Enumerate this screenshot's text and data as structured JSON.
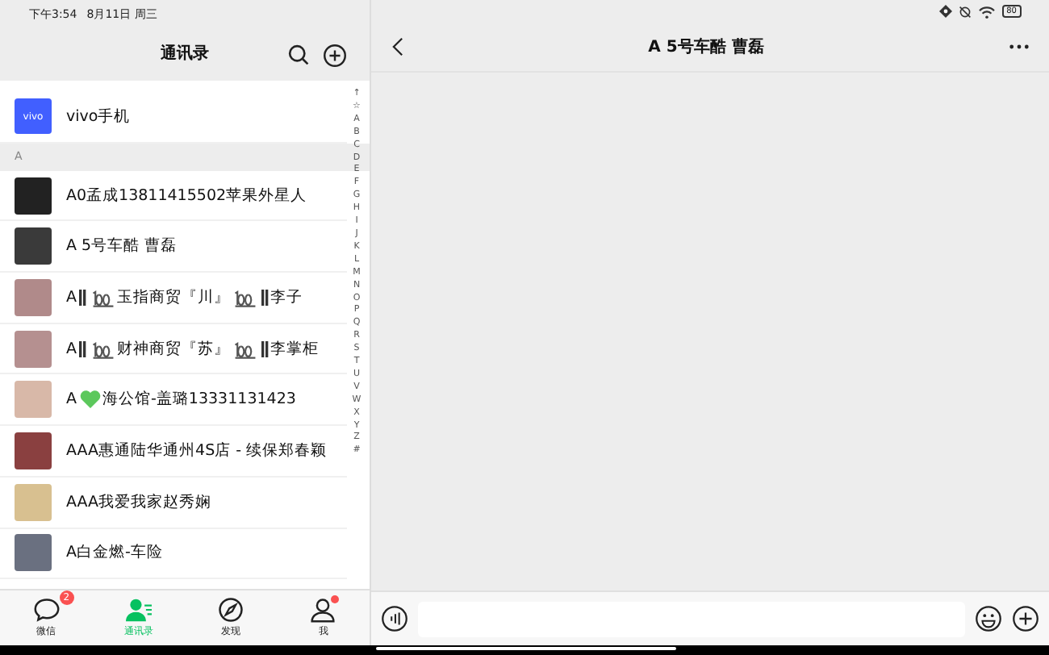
{
  "status_bar": {
    "time": "下午3:54",
    "date": "8月11日 周三",
    "battery": "80"
  },
  "contacts_panel": {
    "title": "通讯录",
    "pinned": {
      "name": "vivo手机",
      "avatar_text": "vivo"
    },
    "section": "A",
    "contacts": [
      {
        "parts": [
          {
            "kind": "text",
            "text": "A0孟成13811415502苹果外星人"
          }
        ],
        "color": "#222222"
      },
      {
        "parts": [
          {
            "kind": "text",
            "text": "A 5号车酷 曹磊"
          }
        ],
        "color": "#3a3a3a"
      },
      {
        "parts": [
          {
            "kind": "text",
            "text": "A"
          },
          {
            "kind": "bars"
          },
          {
            "kind": "hundred"
          },
          {
            "kind": "text",
            "text": "玉指商贸『川』"
          },
          {
            "kind": "hundred"
          },
          {
            "kind": "bars"
          },
          {
            "kind": "text",
            "text": "李子"
          }
        ],
        "color": "#b08a8a"
      },
      {
        "parts": [
          {
            "kind": "text",
            "text": "A"
          },
          {
            "kind": "bars"
          },
          {
            "kind": "hundred"
          },
          {
            "kind": "text",
            "text": "财神商贸『苏』"
          },
          {
            "kind": "hundred"
          },
          {
            "kind": "bars"
          },
          {
            "kind": "text",
            "text": "李掌柜"
          }
        ],
        "color": "#b59090"
      },
      {
        "parts": [
          {
            "kind": "text",
            "text": "A"
          },
          {
            "kind": "heart"
          },
          {
            "kind": "text",
            "text": "海公馆-盖璐13331131423"
          }
        ],
        "color": "#d8b8a8"
      },
      {
        "parts": [
          {
            "kind": "text",
            "text": "AAA惠通陆华通州4S店 - 续保郑春颖"
          }
        ],
        "color": "#8a4040"
      },
      {
        "parts": [
          {
            "kind": "text",
            "text": "AAA我爱我家赵秀娴"
          }
        ],
        "color": "#d8c090"
      },
      {
        "parts": [
          {
            "kind": "text",
            "text": "A白金燃-车险"
          }
        ],
        "color": "#6a7080"
      }
    ],
    "index": [
      "↑",
      "☆",
      "A",
      "B",
      "C",
      "D",
      "E",
      "F",
      "G",
      "H",
      "I",
      "J",
      "K",
      "L",
      "M",
      "N",
      "O",
      "P",
      "Q",
      "R",
      "S",
      "T",
      "U",
      "V",
      "W",
      "X",
      "Y",
      "Z",
      "#"
    ]
  },
  "tab_bar": [
    {
      "label": "微信",
      "kind": "chat",
      "badge": "2",
      "dot": false,
      "selected": false
    },
    {
      "label": "通讯录",
      "kind": "contacts",
      "dot": false,
      "selected": true
    },
    {
      "label": "发现",
      "kind": "compass",
      "dot": false,
      "selected": false
    },
    {
      "label": "我",
      "kind": "person",
      "dot": true,
      "selected": false
    }
  ],
  "chat": {
    "title": "A 5号车酷 曹磊"
  }
}
